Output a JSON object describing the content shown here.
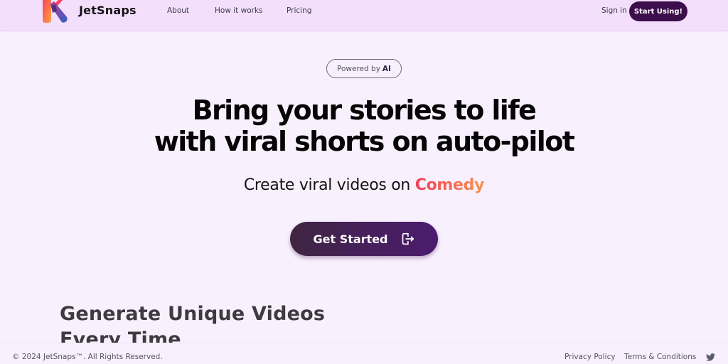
{
  "header": {
    "brand": "JetSnaps",
    "nav": [
      {
        "label": "About"
      },
      {
        "label": "How it works"
      },
      {
        "label": "Pricing"
      }
    ],
    "signin_label": "Sign in",
    "start_label": "Start Using!",
    "logo_icon": "jetsnaps-logo-icon"
  },
  "hero": {
    "badge_prefix": "Powered by",
    "badge_strong": "AI",
    "headline_line1": "Bring your stories to life",
    "headline_line2": "with viral shorts on auto-pilot",
    "subline_prefix": "Create viral videos on",
    "subline_highlight": "Comedy",
    "cta_label": "Get Started",
    "cta_icon": "sign-out-arrow-icon"
  },
  "section": {
    "title_line1": "Generate Unique Videos",
    "title_line2": "Every Time"
  },
  "footer": {
    "copyright": "© 2024 JetSnaps™. All Rights Reserved.",
    "links": [
      {
        "label": "Privacy Policy"
      },
      {
        "label": "Terms & Conditions"
      }
    ],
    "social_icon": "twitter-icon"
  },
  "colors": {
    "header_bg": "#f3dffb",
    "page_bg": "#f9f0fe",
    "primary_dark": "#3c0f4c",
    "highlight_start": "#ef3f5a",
    "highlight_end": "#f9924a"
  }
}
